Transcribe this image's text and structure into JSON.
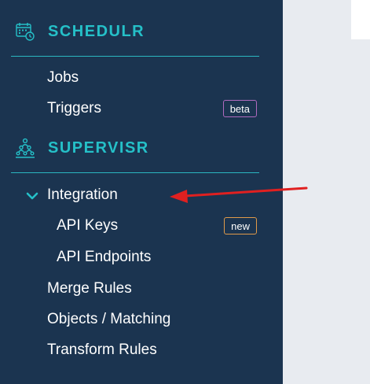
{
  "colors": {
    "sidebar_bg": "#1b3450",
    "accent_teal": "#25c0c8",
    "badge_beta": "#b06abf",
    "badge_new": "#e09a4a",
    "annotation_arrow": "#e02020",
    "content_bg": "#e8ebf0"
  },
  "sections": {
    "schedulr": {
      "title": "SCHEDULR",
      "icon": "calendar-clock-icon",
      "items": [
        {
          "label": "Jobs"
        },
        {
          "label": "Triggers",
          "badge": "beta"
        }
      ]
    },
    "supervisr": {
      "title": "SUPERVISR",
      "icon": "team-hierarchy-icon",
      "items": [
        {
          "label": "Integration",
          "expanded": true,
          "icon": "chevron-down-icon",
          "children": [
            {
              "label": "API Keys",
              "badge": "new"
            },
            {
              "label": "API Endpoints"
            }
          ]
        },
        {
          "label": "Merge Rules"
        },
        {
          "label": "Objects / Matching"
        },
        {
          "label": "Transform Rules"
        }
      ]
    }
  },
  "annotation": {
    "icon": "red-arrow-icon",
    "points_to": "Integration"
  }
}
